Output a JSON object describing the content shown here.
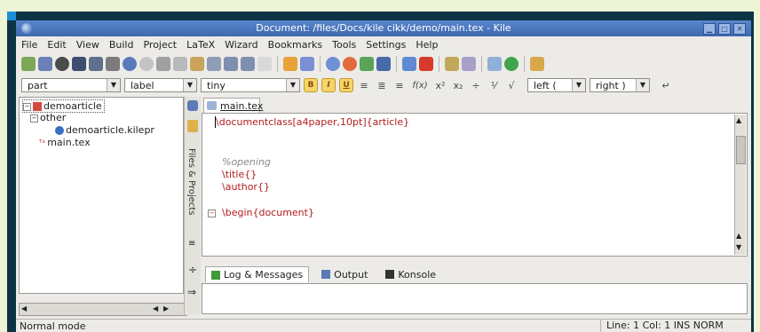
{
  "window": {
    "title": "Document: /files/Docs/kile cikk/demo/main.tex - Kile"
  },
  "menu": [
    "File",
    "Edit",
    "View",
    "Build",
    "Project",
    "LaTeX",
    "Wizard",
    "Bookmarks",
    "Tools",
    "Settings",
    "Help"
  ],
  "toolbar2": {
    "combo1": "part",
    "combo2": "label",
    "combo3": "tiny",
    "bold": "B",
    "italic": "I",
    "underline": "U",
    "func": "f(x)",
    "left_delim": "left (",
    "right_delim": "right )"
  },
  "project_tree": {
    "root": "demoarticle",
    "group": "other",
    "kilepr": "demoarticle.kilepr",
    "main": "main.tex"
  },
  "side_tab": "Files & Projects",
  "editor": {
    "tab": "main.tex",
    "lines": [
      "\\documentclass[a4paper,10pt]{article}",
      "%opening",
      "\\title{}",
      "\\author{}",
      "\\begin{document}"
    ]
  },
  "log_tabs": [
    "Log & Messages",
    "Output",
    "Konsole"
  ],
  "status": {
    "mode": "Normal mode",
    "position": "Line: 1 Col: 1  INS  NORM"
  },
  "colors": {
    "title_bar": "#4a78c0",
    "command": "#b21d1d",
    "comment": "#8a8a8a"
  }
}
